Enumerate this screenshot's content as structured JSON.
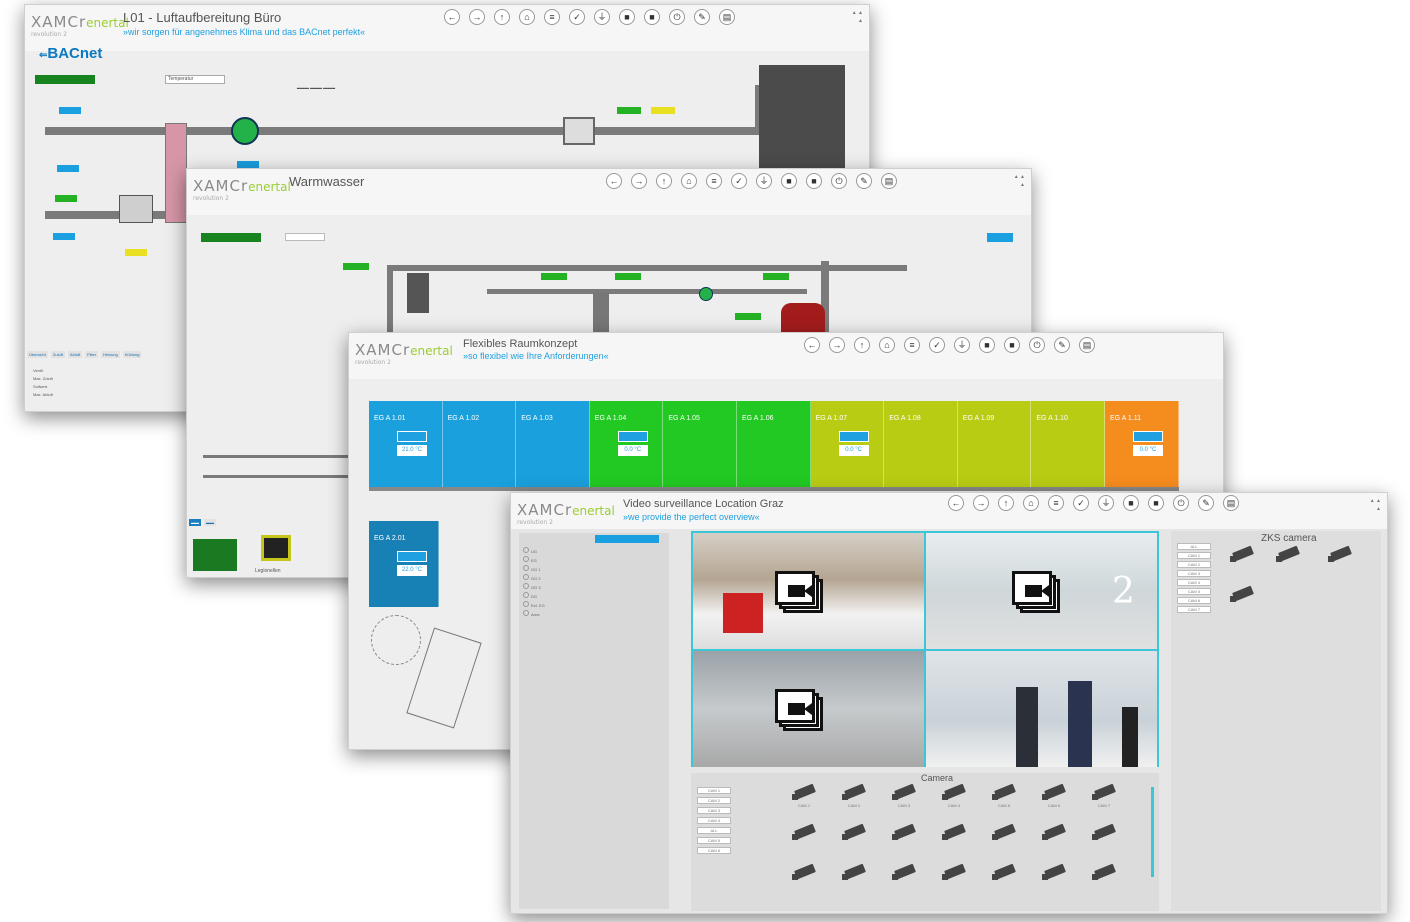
{
  "brand": {
    "name": "XAMCr",
    "accent": "enertal",
    "version": "revolution 2"
  },
  "toolbar_common": [
    "←",
    "→",
    "↑",
    "⌂",
    "≡",
    "✓",
    "⏚",
    "■",
    "■",
    "⏻",
    "✎",
    "▤"
  ],
  "win1": {
    "title": "L01 - Luftaufbereitung Büro",
    "subtitle": "»wir sorgen für angenehmes Klima und das BACnet perfekt«",
    "logo": "BACnet",
    "label_mode": "Temperatur",
    "tabs": [
      "Übersicht",
      "Zuluft",
      "Abluft",
      "Filter",
      "Heizung",
      "Kühlung"
    ],
    "table_rows": [
      "Ventil",
      "Max. Zuluft",
      "Sollwert",
      "Max. Abluft"
    ]
  },
  "win2": {
    "title": "Warmwasser",
    "tab_label": "Legionellen"
  },
  "win3": {
    "title": "Flexibles Raumkonzept",
    "subtitle": "»so flexibel wie Ihre Anforderungen«",
    "rooms_top": [
      {
        "name": "EG A 1.01",
        "color": "#1aa0dc",
        "ist": "21.0 °C"
      },
      {
        "name": "EG A 1.02",
        "color": "#1aa0dc",
        "ist": ""
      },
      {
        "name": "EG A 1.03",
        "color": "#1aa0dc",
        "ist": ""
      },
      {
        "name": "EG A 1.04",
        "color": "#22c922",
        "ist": "0.0 °C"
      },
      {
        "name": "EG A 1.05",
        "color": "#22c922",
        "ist": ""
      },
      {
        "name": "EG A 1.06",
        "color": "#22c922",
        "ist": ""
      },
      {
        "name": "EG A 1.07",
        "color": "#b8cc14",
        "ist": "0.0 °C"
      },
      {
        "name": "EG A 1.08",
        "color": "#b8cc14",
        "ist": ""
      },
      {
        "name": "EG A 1.09",
        "color": "#b8cc14",
        "ist": ""
      },
      {
        "name": "EG A 1.10",
        "color": "#b8cc14",
        "ist": ""
      },
      {
        "name": "EG A 1.11",
        "color": "#f58c1e",
        "ist": "0.0 °C"
      }
    ],
    "rooms_bottom": [
      {
        "name": "EG A 2.01",
        "color": "#1780b4",
        "ist": "22.0 °C"
      }
    ]
  },
  "win4": {
    "title": "Video surveillance Location Graz",
    "subtitle": "»we provide the perfect overview«",
    "tree_items": [
      "UG",
      "EG",
      "OG 1",
      "OG 2",
      "OG 3",
      "DG",
      "Ext. EG",
      "Area"
    ],
    "zone_panel_title": "ZKS camera",
    "tile_number": "2",
    "camera_section_title": "Camera",
    "cam_labels": [
      "CAM 1",
      "CAM 2",
      "CAM 3",
      "CAM 4",
      "CAM 5",
      "CAM 6",
      "CAM 7"
    ],
    "left_buttons": [
      "CAM 1",
      "CAM 2",
      "CAM 3",
      "CAM 4",
      "ALL",
      "CAM 5",
      "CAM 6"
    ],
    "zone_buttons": [
      "ALL",
      "CAM 1",
      "CAM 2",
      "CAM 3",
      "CAM 4",
      "CAM 5",
      "CAM 6",
      "CAM 7"
    ],
    "colors": {
      "frame": "#3cc6d8"
    }
  }
}
